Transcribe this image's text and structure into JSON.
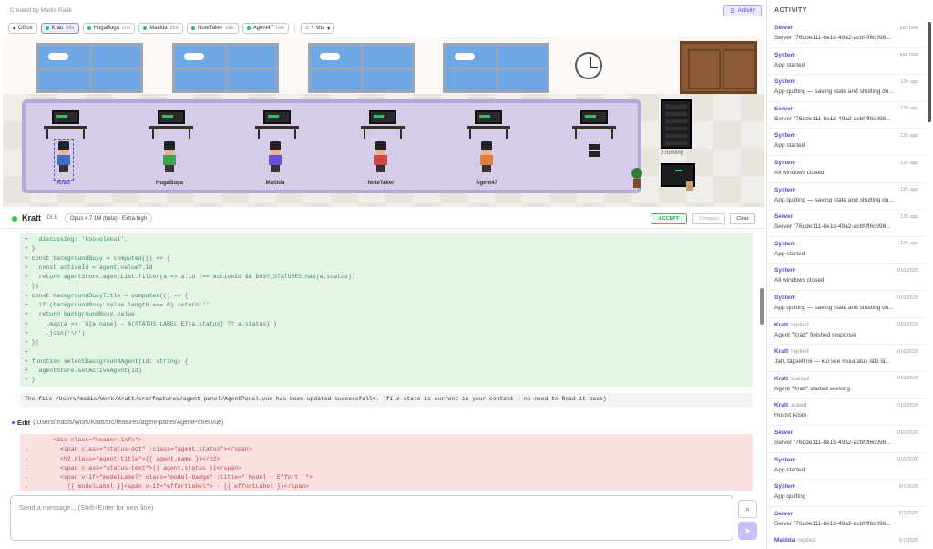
{
  "header": {
    "created_by": "Created by Madis Rääk",
    "activity_button": "Activity"
  },
  "tabs": [
    {
      "label": "Office",
      "status": ""
    },
    {
      "label": "Kratt",
      "status": "idle"
    },
    {
      "label": "HugaBuga",
      "status": "idle"
    },
    {
      "label": "Matilda",
      "status": "idle"
    },
    {
      "label": "NoteTaker",
      "status": "idle"
    },
    {
      "label": "Agent47",
      "status": "idle"
    },
    {
      "label": "vits",
      "status": ""
    }
  ],
  "scene": {
    "agents": [
      {
        "name": "Kratt",
        "shirt": "#3d6fc4"
      },
      {
        "name": "HugaBuga",
        "shirt": "#3fa34d"
      },
      {
        "name": "Matilda",
        "shirt": "#6a4fd8"
      },
      {
        "name": "NoteTaker",
        "shirt": "#d64545"
      },
      {
        "name": "Agent47",
        "shirt": "#e0813a"
      }
    ],
    "running_label": "0 running"
  },
  "agent_header": {
    "name": "Kratt",
    "status": "IDLE",
    "model": "Opus 4.7 1M (beta) · Extra high",
    "accept": "ACCEPT",
    "compact": "Compact",
    "clear": "Clear"
  },
  "diff_add": "+   discussing: 'koosolekul',\n+ }\n+ const backgroundBusy = computed(() => {\n+   const activeId = agent.value?.id\n+   return agentStore.agentList.filter(a => a.id !== activeId && BUSY_STATUSES.has(a.status))\n+ })\n+ const backgroundBusyTitle = computed(() => {\n+   if (backgroundBusy.value.length === 0) return ''\n+   return backgroundBusy.value\n+     .map(a => `${a.name} – ${STATUS_LABEL_ET[a.status] ?? a.status}`)\n+     .join('\\n')\n+ })\n+\n+ function selectBackgroundAgent(id: string) {\n+   agentStore.setActiveAgent(id)\n+ }",
  "result_text": "The file /Users/madis/Work/Kratt/src/features/agent-panel/AgentPanel.vue has been updated successfully. (file state is current in your context — no need to Read it back)",
  "edit_tool": {
    "label": "Edit",
    "path": "(/Users/madis/Work/Kratt/src/features/agent-panel/AgentPanel.vue)"
  },
  "diff_del": "-       <div class=\"header-info\">\n-         <span class=\"status-dot\" :class=\"agent.status\"></span>\n-         <h2 class=\"agent-title\">{{ agent.name }}</h2>\n-         <span class=\"status-text\">{{ agent.status }}</span>\n-         <span v-if=\"modelLabel\" class=\"model-badge\" :title=\"`Model · Effort `\">\n-           {{ modelLabel }}<span v-if=\"effortLabel\"> · {{ effortLabel }}</span>",
  "composer": {
    "placeholder": "Send a message... (Shift+Enter for new line)"
  },
  "activity": {
    "title": "ACTIVITY",
    "items": [
      {
        "who": "Server",
        "action": "",
        "time": "just now",
        "msg": "Server \"76dde111-8e1d-49a2-acbf-ff6c998..."
      },
      {
        "who": "System",
        "action": "",
        "time": "just now",
        "msg": "App started"
      },
      {
        "who": "System",
        "action": "",
        "time": "12h ago",
        "msg": "App quitting — saving state and shutting do..."
      },
      {
        "who": "Server",
        "action": "",
        "time": "12h ago",
        "msg": "Server \"76dde111-8e1d-49a2-acbf-ff6c998..."
      },
      {
        "who": "System",
        "action": "",
        "time": "12h ago",
        "msg": "App started"
      },
      {
        "who": "System",
        "action": "",
        "time": "12h ago",
        "msg": "All windows closed"
      },
      {
        "who": "System",
        "action": "",
        "time": "12h ago",
        "msg": "App quitting — saving state and shutting do..."
      },
      {
        "who": "Server",
        "action": "",
        "time": "12h ago",
        "msg": "Server \"76dde111-8e1d-49a2-acbf-ff6c998..."
      },
      {
        "who": "System",
        "action": "",
        "time": "12h ago",
        "msg": "App started"
      },
      {
        "who": "System",
        "action": "",
        "time": "6/16/2026",
        "msg": "All windows closed"
      },
      {
        "who": "System",
        "action": "",
        "time": "6/16/2026",
        "msg": "App quitting — saving state and shutting do..."
      },
      {
        "who": "Kratt",
        "action": "replied",
        "time": "6/16/2026",
        "msg": "Agent \"Kratt\" finished response"
      },
      {
        "who": "Kratt",
        "action": "replied",
        "time": "6/16/2026",
        "msg": "Jah, täpselt nii — kui see muudatus läbi lä..."
      },
      {
        "who": "Kratt",
        "action": "started",
        "time": "6/16/2026",
        "msg": "Agent \"Kratt\" started working"
      },
      {
        "who": "Kratt",
        "action": "asked",
        "time": "6/16/2026",
        "msg": "Huvist küsin"
      },
      {
        "who": "Server",
        "action": "",
        "time": "6/16/2026",
        "msg": "Server \"76dde111-8e1d-49a2-acbf-ff6c998..."
      },
      {
        "who": "System",
        "action": "",
        "time": "6/16/2026",
        "msg": "App started"
      },
      {
        "who": "System",
        "action": "",
        "time": "6/7/2026",
        "msg": "App quitting"
      },
      {
        "who": "Server",
        "action": "",
        "time": "6/7/2026",
        "msg": "Server \"76dde111-8e1d-49a2-acbf-ff6c998..."
      },
      {
        "who": "Matilda",
        "action": "replied",
        "time": "6/7/2026",
        "msg": ""
      }
    ]
  }
}
